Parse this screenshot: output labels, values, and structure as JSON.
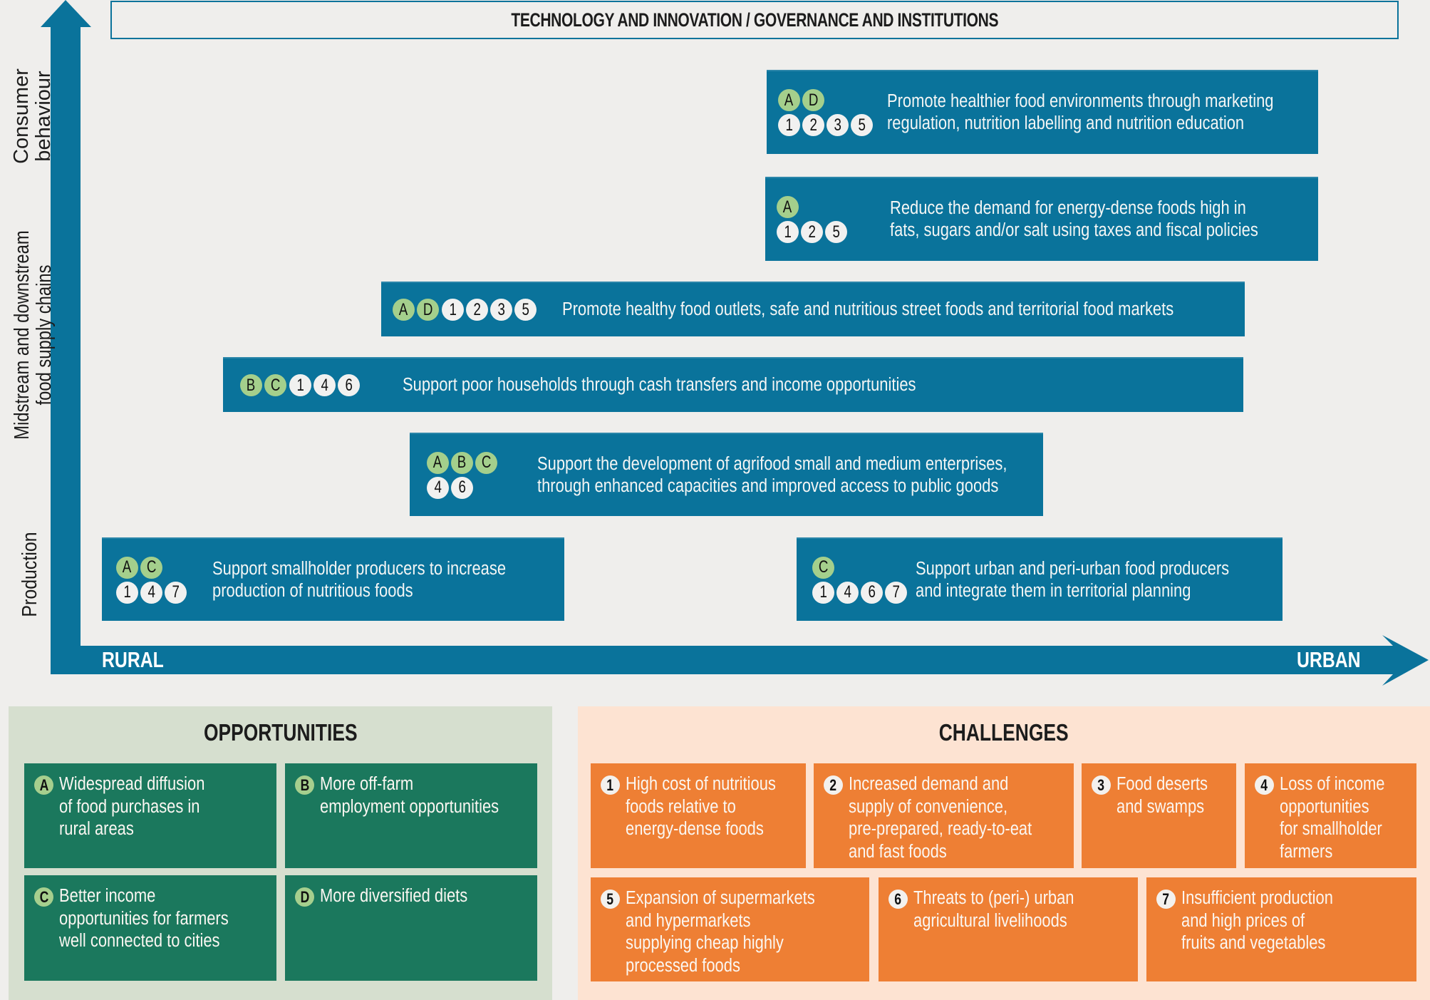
{
  "header": {
    "title": "TECHNOLOGY AND INNOVATION / GOVERNANCE AND INSTITUTIONS"
  },
  "axes": {
    "vertical": {
      "labels": [
        {
          "lines": [
            "Consumer",
            "behaviour"
          ]
        },
        {
          "lines": [
            "Midstream and downstream",
            "food supply chains"
          ]
        },
        {
          "lines": [
            "Production"
          ]
        }
      ]
    },
    "horizontal": {
      "start_label": "RURAL",
      "end_label": "URBAN"
    }
  },
  "colors": {
    "axis_blue": "#0a739b",
    "opportunity_badge": "#a4cf8c",
    "challenge_badge": "#f1f1f0",
    "opportunity_cell": "#1b785d",
    "challenge_cell": "#ee7f34",
    "opportunity_panel": "#d6dfcf",
    "challenge_panel": "#fde3d2"
  },
  "strategies": [
    {
      "opportunities": [
        "A",
        "D"
      ],
      "challenges": [
        "1",
        "2",
        "3",
        "5"
      ],
      "lines": [
        "Promote healthier food environments through marketing",
        "regulation, nutrition labelling and nutrition education"
      ]
    },
    {
      "opportunities": [
        "A"
      ],
      "challenges": [
        "1",
        "2",
        "5"
      ],
      "lines": [
        "Reduce the demand for energy-dense foods high in",
        "fats, sugars and/or salt using taxes and fiscal policies"
      ]
    },
    {
      "opportunities": [
        "A",
        "D"
      ],
      "challenges": [
        "1",
        "2",
        "3",
        "5"
      ],
      "lines": [
        "Promote healthy food outlets, safe and nutritious street foods and territorial food markets"
      ]
    },
    {
      "opportunities": [
        "B",
        "C"
      ],
      "challenges": [
        "1",
        "4",
        "6"
      ],
      "lines": [
        "Support poor households through cash transfers and income opportunities"
      ]
    },
    {
      "opportunities": [
        "A",
        "B",
        "C"
      ],
      "challenges": [
        "4",
        "6"
      ],
      "lines": [
        "Support the development of agrifood small and medium enterprises,",
        "through enhanced capacities and improved access to public goods"
      ]
    },
    {
      "opportunities": [
        "A",
        "C"
      ],
      "challenges": [
        "1",
        "4",
        "7"
      ],
      "lines": [
        "Support smallholder producers to increase",
        "production of nutritious foods"
      ]
    },
    {
      "opportunities": [
        "C"
      ],
      "challenges": [
        "1",
        "4",
        "6",
        "7"
      ],
      "lines": [
        "Support urban and peri-urban food producers",
        "and integrate them in territorial planning"
      ]
    }
  ],
  "opportunities": {
    "title": "OPPORTUNITIES",
    "items": [
      {
        "id": "A",
        "lines": [
          "Widespread diffusion",
          "of food purchases in",
          "rural areas"
        ]
      },
      {
        "id": "B",
        "lines": [
          "More off-farm",
          "employment opportunities"
        ]
      },
      {
        "id": "C",
        "lines": [
          "Better income",
          "opportunities for farmers",
          "well connected to cities"
        ]
      },
      {
        "id": "D",
        "lines": [
          "More diversified diets"
        ]
      }
    ]
  },
  "challenges": {
    "title": "CHALLENGES",
    "items": [
      {
        "id": "1",
        "lines": [
          "High cost of nutritious",
          "foods relative to",
          "energy-dense foods"
        ]
      },
      {
        "id": "2",
        "lines": [
          "Increased demand and",
          "supply of convenience,",
          "pre-prepared, ready-to-eat",
          "and fast foods"
        ]
      },
      {
        "id": "3",
        "lines": [
          "Food deserts",
          "and swamps"
        ]
      },
      {
        "id": "4",
        "lines": [
          "Loss of income",
          "opportunities",
          "for smallholder",
          "farmers"
        ]
      },
      {
        "id": "5",
        "lines": [
          "Expansion of supermarkets",
          "and hypermarkets",
          "supplying cheap highly",
          "processed foods"
        ]
      },
      {
        "id": "6",
        "lines": [
          "Threats to (peri-) urban",
          "agricultural livelihoods"
        ]
      },
      {
        "id": "7",
        "lines": [
          "Insufficient production",
          "and high prices of",
          "fruits and vegetables"
        ]
      }
    ]
  }
}
